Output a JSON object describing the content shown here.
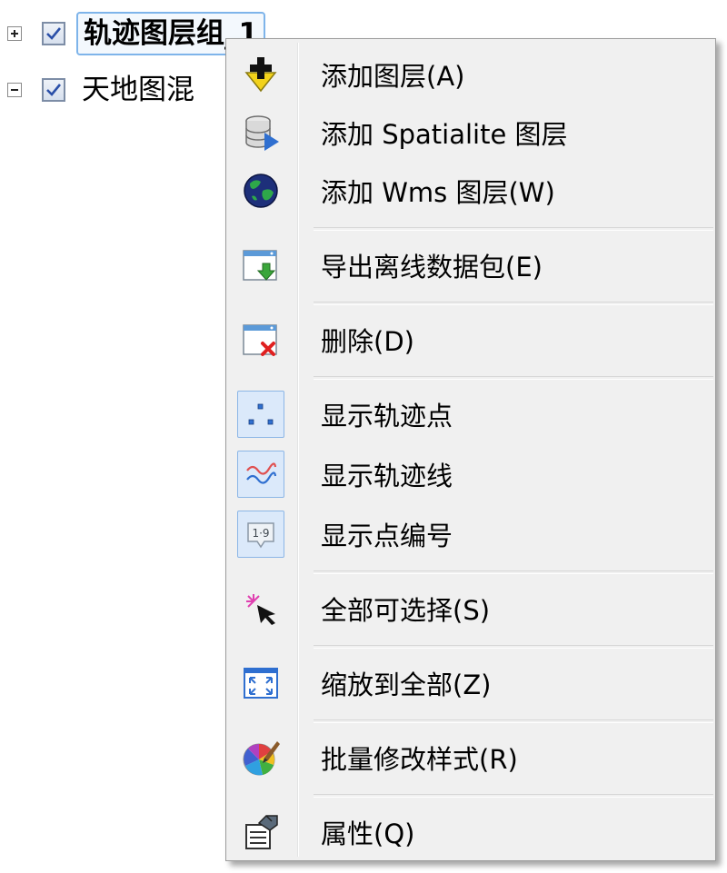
{
  "tree": {
    "nodes": [
      {
        "label": "轨迹图层组_1",
        "checked": true,
        "expanded": false,
        "selected": true
      },
      {
        "label": "天地图混",
        "checked": true,
        "expanded": true,
        "selected": false
      }
    ]
  },
  "context_menu": {
    "items": [
      {
        "label": "添加图层(A)",
        "icon": "add-layer-icon"
      },
      {
        "label": "添加 Spatialite 图层",
        "icon": "database-layer-icon"
      },
      {
        "label": "添加 Wms 图层(W)",
        "icon": "globe-icon"
      },
      {
        "label": "导出离线数据包(E)",
        "icon": "export-package-icon"
      },
      {
        "label": "删除(D)",
        "icon": "delete-window-icon"
      },
      {
        "label": "显示轨迹点",
        "icon": "track-points-icon",
        "checked": true
      },
      {
        "label": "显示轨迹线",
        "icon": "track-line-icon",
        "checked": true
      },
      {
        "label": "显示点编号",
        "icon": "point-number-icon",
        "checked": true
      },
      {
        "label": "全部可选择(S)",
        "icon": "select-all-cursor-icon"
      },
      {
        "label": "缩放到全部(Z)",
        "icon": "zoom-extent-icon"
      },
      {
        "label": "批量修改样式(R)",
        "icon": "style-palette-icon"
      },
      {
        "label": "属性(Q)",
        "icon": "properties-icon"
      }
    ],
    "point_number_icon_text": "1·9"
  },
  "colors": {
    "selection_border": "#7eb4ea",
    "menu_background": "#f0f0f0",
    "checked_item_frame": "#8cb6e6",
    "delete_red": "#e02020",
    "export_green": "#3aa63a"
  }
}
